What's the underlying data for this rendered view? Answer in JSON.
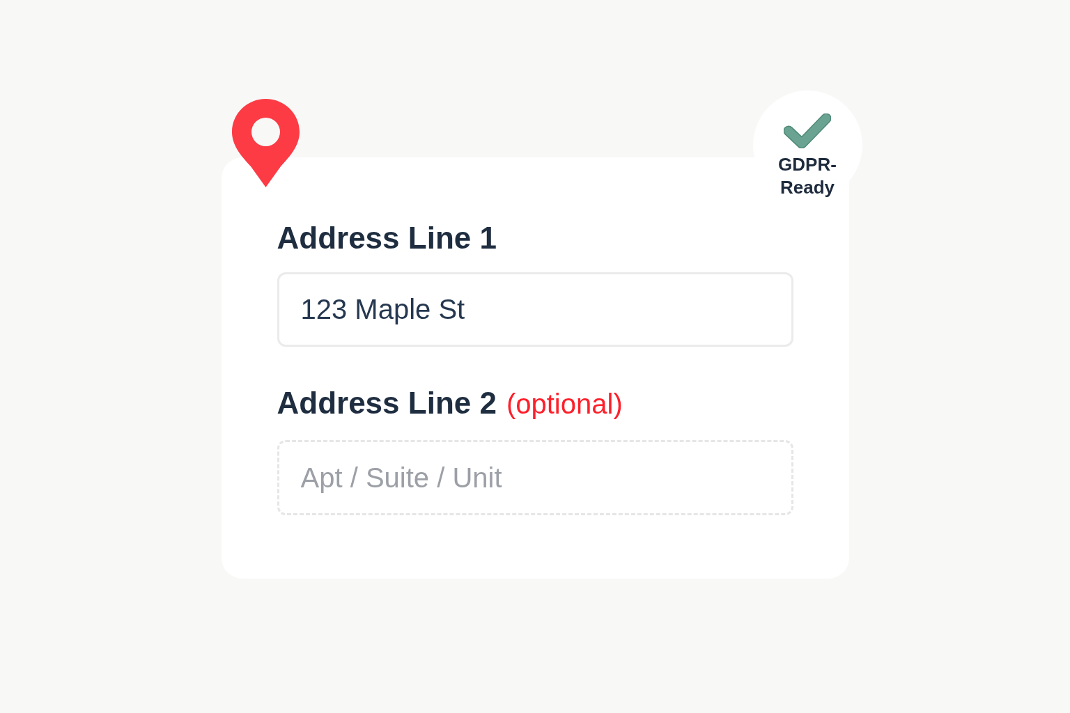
{
  "badge": {
    "label": "GDPR-Ready"
  },
  "fields": [
    {
      "label": "Address Line 1",
      "value": "123 Maple St",
      "optional": false
    },
    {
      "label": "Address Line 2",
      "note": "(optional)",
      "placeholder": "Apt / Suite / Unit",
      "optional": true
    }
  ]
}
